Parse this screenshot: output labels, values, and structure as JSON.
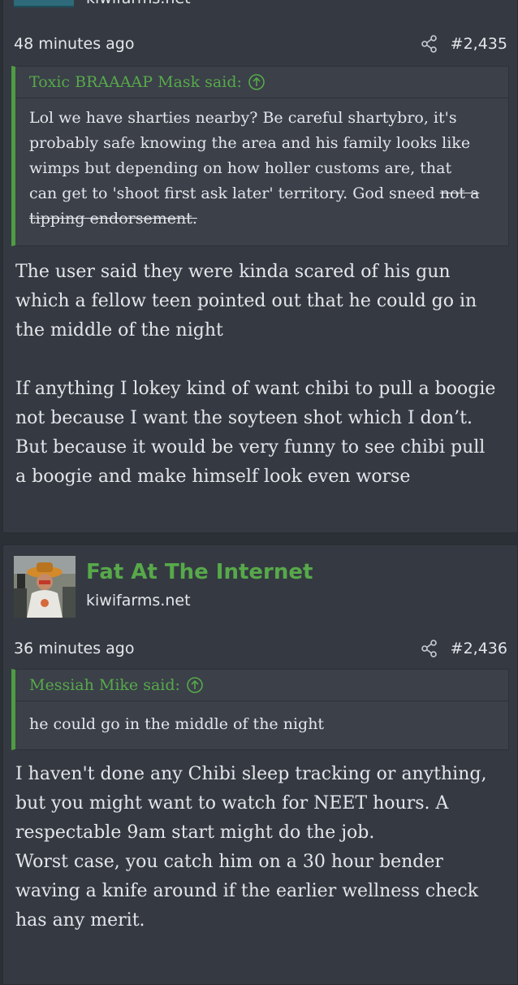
{
  "post1": {
    "header_site_cut": "kiwifarms.net",
    "time": "48 minutes ago",
    "share_icon": "share-icon",
    "number": "#2,435",
    "quote": {
      "author": "Toxic BRAAAAP Mask said:",
      "lines": [
        "Lol we have sharties nearby? Be careful shartybro, it's",
        "probably safe knowing the area and his family looks like",
        "wimps but depending on how holler customs are, that",
        "can get to 'shoot first ask later' territory. God sneed "
      ],
      "strike_part1": "not a",
      "strike_part2": "tipping endorsement."
    },
    "body": {
      "p1": [
        "The user said they were kinda scared of his gun",
        "which a fellow teen pointed out that he could go in",
        "the middle of the night"
      ],
      "p2": [
        "If anything I lokey kind of want chibi to pull a boogie",
        "not because I want the soyteen shot which I don’t.",
        "But because it would be very funny to see chibi pull",
        "a boogie and make himself look even worse"
      ]
    }
  },
  "post2": {
    "author": "Fat At The Internet",
    "site": "kiwifarms.net",
    "time": "36 minutes ago",
    "share_icon": "share-icon",
    "number": "#2,436",
    "quote": {
      "author": "Messiah Mike said:",
      "lines": [
        "he could go in the middle of the night"
      ]
    },
    "body": {
      "lines": [
        "I haven't done any Chibi sleep tracking or anything,",
        "but you might want to watch for NEET hours. A",
        "respectable 9am start might do the job.",
        "Worst case, you catch him on a 30 hour bender",
        "waving a knife around if the earlier wellness check",
        "has any merit."
      ]
    }
  },
  "colors": {
    "page_bg": "#2b2f36",
    "post_bg": "#353a42",
    "quote_bg": "#3b4049",
    "accent_green": "#57a94a",
    "quote_bar": "#4f9c45",
    "text": "#e4e6ea"
  }
}
